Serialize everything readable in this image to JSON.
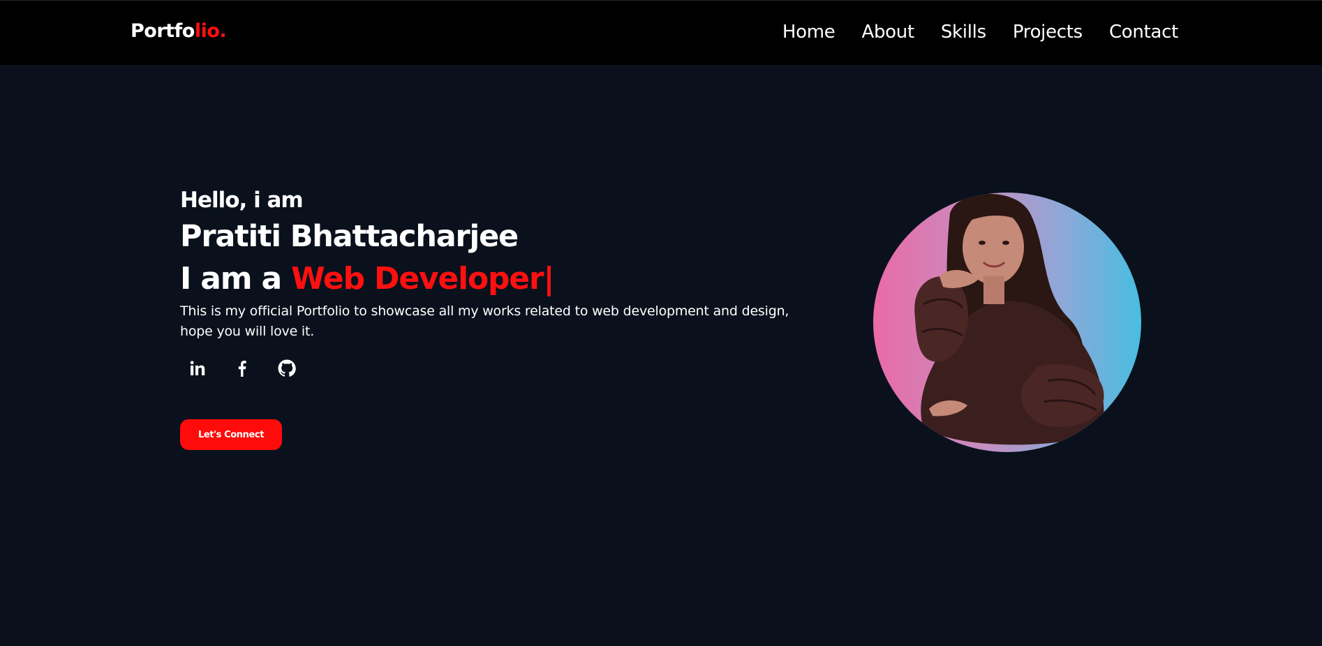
{
  "brand": {
    "text_main": "Portfo",
    "text_accent": "lio."
  },
  "nav": {
    "items": [
      {
        "label": "Home"
      },
      {
        "label": "About"
      },
      {
        "label": "Skills"
      },
      {
        "label": "Projects"
      },
      {
        "label": "Contact"
      }
    ]
  },
  "hero": {
    "greeting": "Hello, i am",
    "name": "Pratiti Bhattacharjee",
    "role_prefix": "I am a ",
    "role": "Web Developer",
    "cursor": "|",
    "description": "This is my official Portfolio to showcase all my works related to web development and design, hope you will love it.",
    "cta_label": "Let's Connect"
  },
  "socials": [
    {
      "icon": "linkedin-icon"
    },
    {
      "icon": "facebook-icon"
    },
    {
      "icon": "github-icon"
    }
  ],
  "colors": {
    "background": "#0a111c",
    "navbar": "#000000",
    "accent": "#ff1010",
    "text": "#ffffff"
  },
  "profile_photo": {
    "icon": "profile-photo"
  }
}
